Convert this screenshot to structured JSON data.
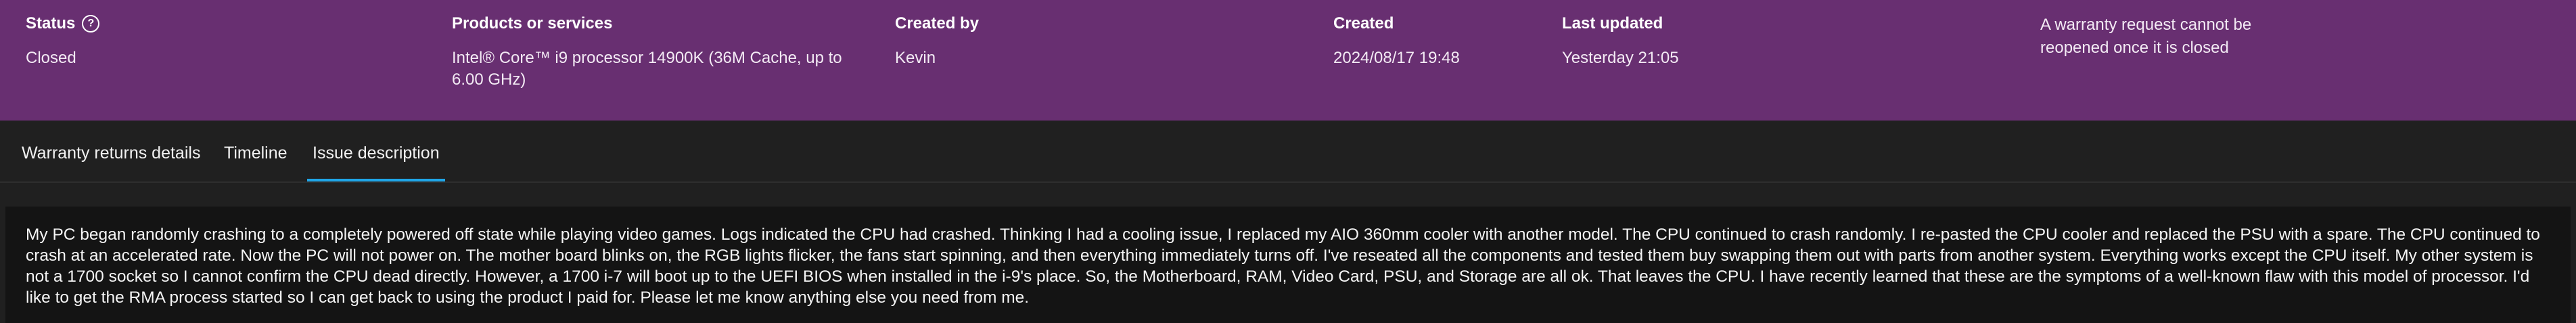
{
  "header": {
    "status": {
      "label": "Status",
      "value": "Closed"
    },
    "products": {
      "label": "Products or services",
      "value": "Intel® Core™ i9 processor 14900K (36M Cache, up to 6.00 GHz)"
    },
    "created_by": {
      "label": "Created by",
      "value": "Kevin"
    },
    "created": {
      "label": "Created",
      "value": "2024/08/17 19:48"
    },
    "last_updated": {
      "label": "Last updated",
      "value": "Yesterday 21:05"
    },
    "note": "A warranty request cannot be reopened once it is closed"
  },
  "help_icon_glyph": "?",
  "tabs": [
    {
      "label": "Warranty returns details"
    },
    {
      "label": "Timeline"
    },
    {
      "label": "Issue description",
      "active": true
    }
  ],
  "issue": {
    "text": "My PC began randomly crashing to a completely powered off state while playing video games. Logs indicated the CPU had crashed. Thinking I had a cooling issue, I replaced my AIO 360mm cooler with another model. The CPU continued to crash randomly. I re-pasted the CPU cooler and replaced the PSU with a spare. The CPU continued to crash at an accelerated rate. Now the PC will not power on. The mother board blinks on, the RGB lights flicker, the fans start spinning, and then everything immediately turns off. I've reseated all the components and tested them buy swapping them out with parts from another system. Everything works except the CPU itself. My other system is not a 1700 socket so I cannot confirm the CPU dead directly. However, a 1700 i-7 will boot up to the UEFI BIOS when installed in the i-9's place. So, the Motherboard, RAM, Video Card, PSU, and Storage are all ok. That leaves the CPU. I have recently learned that these are the symptoms of a well-known flaw with this model of processor. I'd like to get the RMA process started so I can get back to using the product I paid for. Please let me know anything else you need from me."
  },
  "colors": {
    "header_bg": "#682f71",
    "page_bg": "#202020",
    "active_tab_underline": "#1fa6e8",
    "issue_bg": "#141414"
  },
  "icons": [
    "help-circle-icon"
  ]
}
